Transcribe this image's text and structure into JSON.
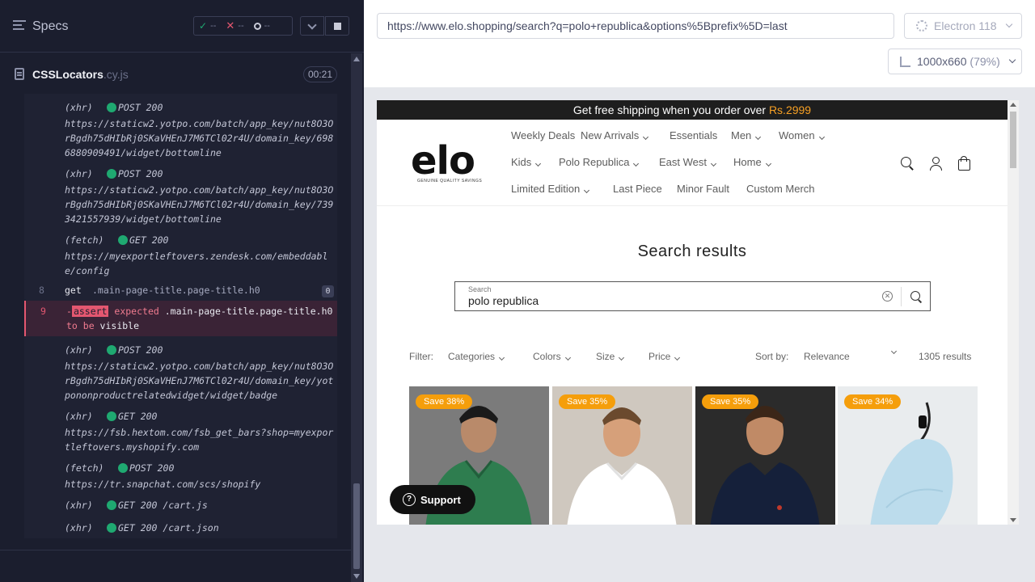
{
  "runner": {
    "specs_title": "Specs",
    "stats": {
      "passed": "--",
      "failed": "--",
      "pending": "--"
    },
    "file": {
      "name": "CSSLocators",
      "ext": ".cy.js",
      "duration": "00:21"
    },
    "commands": [
      {
        "type": "(xhr)",
        "method": "POST 200",
        "url": "https://staticw2.yotpo.com/batch/app_key/nut8O3OrBgdh75dHIbRj0SKaVHEnJ7M6TCl02r4U/domain_key/6986880909491/widget/bottomline"
      },
      {
        "type": "(xhr)",
        "method": "POST 200",
        "url": "https://staticw2.yotpo.com/batch/app_key/nut8O3OrBgdh75dHIbRj0SKaVHEnJ7M6TCl02r4U/domain_key/7393421557939/widget/bottomline"
      },
      {
        "type": "(fetch)",
        "method": "GET 200",
        "url": "https://myexportleftovers.zendesk.com/embeddable/config"
      },
      {
        "type": "(xhr)",
        "method": "POST 200",
        "url": "https://staticw2.yotpo.com/batch/app_key/nut8O3OrBgdh75dHIbRj0SKaVHEnJ7M6TCl02r4U/domain_key/yotpononproductrelatedwidget/widget/badge"
      },
      {
        "type": "(xhr)",
        "method": "GET 200",
        "url": "https://fsb.hextom.com/fsb_get_bars?shop=myexportleftovers.myshopify.com"
      },
      {
        "type": "(fetch)",
        "method": "POST 200",
        "url": "https://tr.snapchat.com/scs/shopify"
      },
      {
        "type": "(xhr)",
        "method": "GET 200 /cart.js",
        "url": ""
      },
      {
        "type": "(xhr)",
        "method": "GET 200 /cart.json",
        "url": ""
      }
    ],
    "get_cmd": {
      "num": "8",
      "keyword": "get",
      "selector": ".main-page-title.page-title.h0",
      "count": "0"
    },
    "assert_cmd": {
      "num": "9",
      "prefix": "-",
      "tag": "assert",
      "text1": " expected ",
      "selector": ".main-page-title.page-title.h0",
      "text2": " to be ",
      "word": "visible"
    }
  },
  "preview": {
    "url": "https://www.elo.shopping/search?q=polo+republica&options%5Bprefix%5D=last",
    "browser": "Electron 118",
    "viewport": "1000x660",
    "scale": "(79%)"
  },
  "site": {
    "promo_text": "Get free shipping when you order over ",
    "promo_highlight": "Rs.2999",
    "logo": "elo",
    "logo_tagline": "GENUINE QUALITY SAVINGS",
    "nav": [
      {
        "label": "Weekly Deals",
        "dropdown": false
      },
      {
        "label": "New Arrivals",
        "dropdown": true
      },
      {
        "label": "Essentials",
        "dropdown": false
      },
      {
        "label": "Men",
        "dropdown": true
      },
      {
        "label": "Women",
        "dropdown": true
      },
      {
        "label": "Kids",
        "dropdown": true
      },
      {
        "label": "Polo Republica",
        "dropdown": true
      },
      {
        "label": "East West",
        "dropdown": true
      },
      {
        "label": "Home",
        "dropdown": true
      },
      {
        "label": "Limited Edition",
        "dropdown": true
      },
      {
        "label": "Last Piece",
        "dropdown": false
      },
      {
        "label": "Minor Fault",
        "dropdown": false
      },
      {
        "label": "Custom Merch",
        "dropdown": false
      }
    ],
    "results_title": "Search results",
    "search_label": "Search",
    "search_value": "polo republica",
    "filter_label": "Filter:",
    "filters": [
      "Categories",
      "Colors",
      "Size",
      "Price"
    ],
    "sort_label": "Sort by:",
    "sort_value": "Relevance",
    "results_count": "1305 results",
    "products": [
      {
        "save": "Save 38%",
        "color": "#2e7d4f"
      },
      {
        "save": "Save 35%",
        "color": "#ffffff"
      },
      {
        "save": "Save 35%",
        "color": "#15203a"
      },
      {
        "save": "Save 34%",
        "color": "#bcdcec"
      }
    ],
    "support_label": "Support"
  }
}
